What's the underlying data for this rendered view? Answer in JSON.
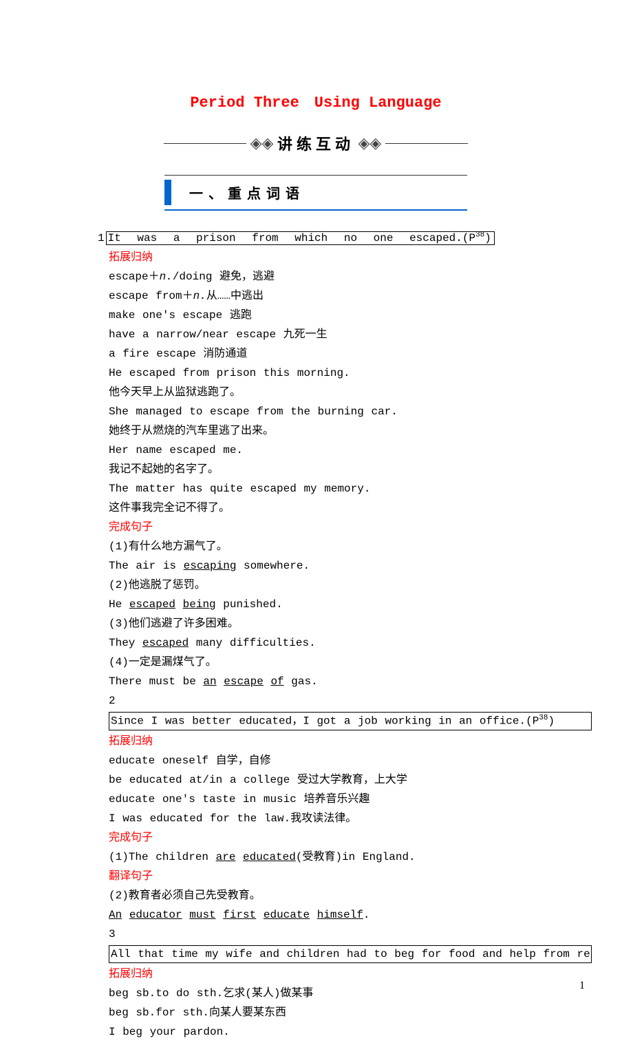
{
  "title": "Period Three　Using Language",
  "decor": {
    "text": "讲练互动"
  },
  "section1": {
    "label": "一、重点词语"
  },
  "item1": {
    "num": "1",
    "box": "It  was  a  prison  from  which  no  one  escaped.(P",
    "box_sup": "38",
    "box_end": ")",
    "red1": "拓展归纳",
    "l1_a": "escape＋",
    "l1_b": "n.",
    "l1_c": "/doing 避免，逃避",
    "l2": "escape from＋",
    "l2_b": "n.",
    "l2_c": "从……中逃出",
    "l3": "make one's escape 逃跑",
    "l4": "have a narrow/near escape 九死一生",
    "l5": "a fire escape 消防通道",
    "l6": "He escaped from prison this morning.",
    "l7": "他今天早上从监狱逃跑了。",
    "l8": "She managed to escape from the burning car.",
    "l9": "她终于从燃烧的汽车里逃了出来。",
    "l10": "Her name escaped me.",
    "l11": "我记不起她的名字了。",
    "l12": "The matter has quite escaped my memory.",
    "l13": "这件事我完全记不得了。",
    "red2": "完成句子",
    "q1": "(1)有什么地方漏气了。",
    "a1_a": "The air is ",
    "a1_u": "escaping",
    "a1_b": " somewhere.",
    "q2": "(2)他逃脱了惩罚。",
    "a2_a": "He ",
    "a2_u1": "escaped",
    "a2_m": " ",
    "a2_u2": "being",
    "a2_b": " punished.",
    "q3": "(3)他们逃避了许多困难。",
    "a3_a": "They ",
    "a3_u": "escaped",
    "a3_b": " many difficulties.",
    "q4": "(4)一定是漏煤气了。",
    "a4_a": "There must be ",
    "a4_u1": "an",
    "a4_m1": " ",
    "a4_u2": "escape",
    "a4_m2": " ",
    "a4_u3": "of",
    "a4_b": " gas."
  },
  "item2": {
    "num": "2",
    "box": "Since  I  was  better  educated，I  got  a  job  working  in  an  office.(P",
    "box_sup": "38",
    "box_end": ")",
    "red1": "拓展归纳",
    "l1": "educate oneself 自学，自修",
    "l2": "be educated at/in a college 受过大学教育，上大学",
    "l3": "educate one's taste in music 培养音乐兴趣",
    "l4": "I was educated for the law.我攻读法律。",
    "red2": "完成句子",
    "q1_a": "(1)The children ",
    "q1_u1": "are",
    "q1_m": " ",
    "q1_u2": "educated",
    "q1_b": "(受教育)in England.",
    "red3": "翻译句子",
    "q2": "(2)教育者必须自己先受教育。",
    "a2_u1": "An",
    "a2_s1": " ",
    "a2_u2": "educator",
    "a2_s2": " ",
    "a2_u3": "must",
    "a2_s3": " ",
    "a2_u4": "first",
    "a2_s4": " ",
    "a2_u5": "educate",
    "a2_s5": " ",
    "a2_u6": "himself",
    "a2_end": "."
  },
  "item3": {
    "num": "3",
    "box": "All  that  time  my  wife  and  children  had  to  beg  for  food  and  help  from  relatives  o",
    "red1": "拓展归纳",
    "l1": "beg sb.to do sth.乞求(某人)做某事",
    "l2": "beg sb.for sth.向某人要某东西",
    "l3": "I beg your pardon."
  },
  "footer": {
    "page": "1"
  }
}
